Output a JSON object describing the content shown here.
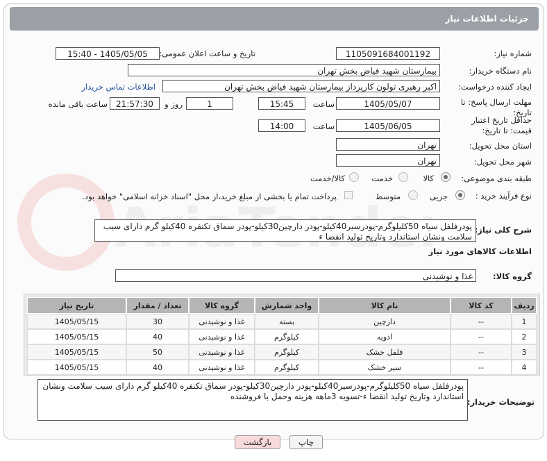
{
  "header": {
    "title": "جزئیات اطلاعات نیاز"
  },
  "fields": {
    "need_number_label": "شماره نیاز:",
    "need_number": "1105091684001192",
    "announce_label": "تاریخ و ساعت اعلان عمومی:",
    "announce_value": "1405/05/05 - 15:40",
    "buyer_org_label": "نام دستگاه خریدار:",
    "buyer_org": "بیمارستان شهید فیاض بخش تهران",
    "creator_label": "ایجاد کننده درخواست:",
    "creator": "اکبر رهبری تولون کارپرداز بیمارستان شهید فیاض بخش تهران",
    "contact_link": "اطلاعات تماس خریدار",
    "deadline_label": "مهلت ارسال پاسخ: تا تاریخ:",
    "deadline_date": "1405/05/07",
    "time_word": "ساعت",
    "deadline_time": "15:45",
    "days_value": "1",
    "days_word": "روز و",
    "remaining_value": "21:57:30",
    "remaining_word": "ساعت باقی مانده",
    "validity_label": "حداقل تاریخ اعتبار قیمت: تا تاریخ:",
    "validity_date": "1405/06/05",
    "validity_time": "14:00",
    "province_label": "استان محل تحویل:",
    "province": "تهران",
    "city_label": "شهر محل تحویل:",
    "city": "تهران",
    "category_label": "طبقه بندی موضوعی:",
    "category_options": [
      "کالا",
      "خدمت",
      "کالا/خدمت"
    ],
    "process_label": "نوع فرآیند خرید :",
    "process_options": [
      "جزیی",
      "متوسط"
    ],
    "payment_note": "پرداخت تمام یا بخشی از مبلغ خرید،از محل \"اسناد خزانه اسلامی\" خواهد بود.",
    "summary_label": "شرح کلی نیاز:",
    "summary": "پودرفلفل سیاه 50کلیلوگرم-پودرسیر40کیلو-پودر دارچین30کیلو-پودر سماق تکنفره 40کیلو گرم دارای سیب سلامت ونشان استاندارد وتاریخ تولید انقضا ء",
    "goods_info_title": "اطلاعات کالاهای مورد نیاز",
    "goods_group_label": "گروه کالا:",
    "goods_group": "غذا و نوشیدنی",
    "buyer_notes_label": "توضیحات خریدار:",
    "buyer_notes": "پودرفلفل سیاه 50کلیلوگرم-پودرسیر40کیلو-پودر دارچین30کیلو-پودر سماق تکنفره 40کیلو گرم دارای سیب سلامت ونشان استاندارد وتاریخ تولید انقضا ء-تسویه 3ماهه هزینه وحمل با فروشنده"
  },
  "table": {
    "headers": [
      "ردیف",
      "کد کالا",
      "نام کالا",
      "واحد شمارش",
      "گروه کالا",
      "تعداد / مقدار",
      "تاریخ نیاز"
    ],
    "rows": [
      [
        "1",
        "--",
        "دارچین",
        "بسته",
        "غذا و نوشیدنی",
        "30",
        "1405/05/15"
      ],
      [
        "2",
        "--",
        "ادویه",
        "کیلوگرم",
        "غذا و نوشیدنی",
        "40",
        "1405/05/15"
      ],
      [
        "3",
        "--",
        "فلفل خشک",
        "کیلوگرم",
        "غذا و نوشیدنی",
        "50",
        "1405/05/15"
      ],
      [
        "4",
        "--",
        "سیر خشک",
        "کیلوگرم",
        "غذا و نوشیدنی",
        "40",
        "1405/05/15"
      ]
    ]
  },
  "buttons": {
    "print": "چاپ",
    "back": "بازگشت"
  },
  "watermark": "AriaTender.net",
  "colors": {
    "header": "#9aa0a6",
    "link": "#1f4e9a",
    "back_button": "#f8dada"
  }
}
